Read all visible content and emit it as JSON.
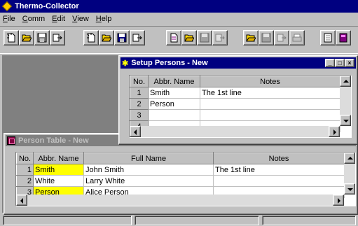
{
  "app": {
    "title": "Thermo-Collector"
  },
  "menu": [
    {
      "label": "File",
      "u": "F",
      "rest": "ile"
    },
    {
      "label": "Comm",
      "u": "C",
      "rest": "omm"
    },
    {
      "label": "Edit",
      "u": "E",
      "rest": "dit"
    },
    {
      "label": "View",
      "u": "V",
      "rest": "iew"
    },
    {
      "label": "Help",
      "u": "H",
      "rest": "elp"
    }
  ],
  "toolbar": {
    "buttons": [
      "new-icon",
      "open-icon",
      "save-icon",
      "export-icon",
      "new-icon",
      "open-icon",
      "save-icon",
      "export-icon",
      "new-icon",
      "open-icon",
      "save-icon",
      "export-icon",
      "open-icon",
      "save-icon",
      "export-icon",
      "print-icon",
      "notes-icon",
      "book-icon"
    ]
  },
  "setup_window": {
    "title": "Setup Persons - New",
    "columns": [
      "No.",
      "Abbr. Name",
      "Notes"
    ],
    "rows": [
      {
        "no": "1",
        "abbr": "Smith",
        "notes": "The 1st line"
      },
      {
        "no": "2",
        "abbr": "Person",
        "notes": ""
      },
      {
        "no": "3",
        "abbr": "",
        "notes": ""
      },
      {
        "no": "4",
        "abbr": "",
        "notes": ""
      }
    ]
  },
  "person_window": {
    "title": "Person Table - New",
    "columns": [
      "No.",
      "Abbr. Name",
      "Full Name",
      "Notes"
    ],
    "rows": [
      {
        "no": "1",
        "abbr": "Smith",
        "full": "John Smith",
        "notes": "The 1st line",
        "highlight": true
      },
      {
        "no": "2",
        "abbr": "White",
        "full": "Larry White",
        "notes": "",
        "highlight": false
      },
      {
        "no": "3",
        "abbr": "Person",
        "full": "Alice Person",
        "notes": "",
        "highlight": true
      }
    ]
  },
  "colors": {
    "active_title": "#000080",
    "inactive_title": "#808080",
    "highlight": "#ffff00"
  }
}
